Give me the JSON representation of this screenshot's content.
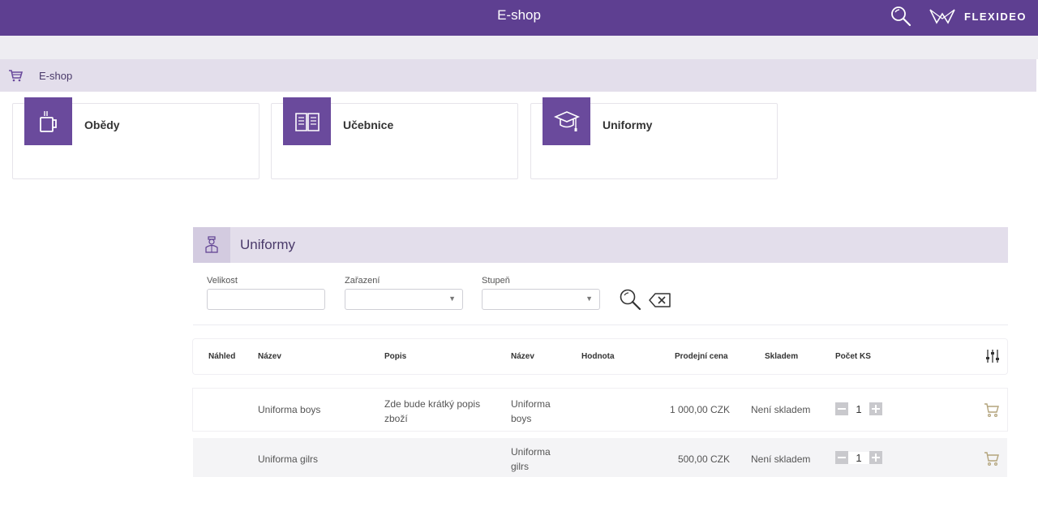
{
  "app": {
    "title": "E-shop",
    "brand": "FLEXIDEO"
  },
  "breadcrumb": {
    "label": "E-shop"
  },
  "categories": [
    {
      "label": "Obědy",
      "icon": "mug-icon"
    },
    {
      "label": "Učebnice",
      "icon": "book-icon"
    },
    {
      "label": "Uniformy",
      "icon": "graduation-cap-icon"
    }
  ],
  "panel": {
    "title": "Uniformy",
    "icon": "uniform-person-icon",
    "filters": {
      "velikost": {
        "label": "Velikost",
        "value": ""
      },
      "zarazeni": {
        "label": "Zařazení",
        "value": ""
      },
      "stupen": {
        "label": "Stupeň",
        "value": ""
      }
    }
  },
  "table": {
    "columns": [
      "Náhled",
      "Název",
      "Popis",
      "Název",
      "Hodnota",
      "Prodejní cena",
      "Skladem",
      "Počet KS"
    ],
    "rows": [
      {
        "nahled": "",
        "nazev": "Uniforma boys",
        "popis": "Zde bude krátký popis zboží",
        "nazev2": "Uniforma boys",
        "hodnota": "",
        "cena": "1 000,00 CZK",
        "skladem": "Není skladem",
        "pocet": "1"
      },
      {
        "nahled": "",
        "nazev": "Uniforma gilrs",
        "popis": "",
        "nazev2": "Uniforma gilrs",
        "hodnota": "",
        "cena": "500,00 CZK",
        "skladem": "Není skladem",
        "pocet": "1"
      }
    ]
  },
  "colors": {
    "accent": "#5e3f91",
    "tile": "#6a4a9c",
    "headerBg": "#e3deeb"
  }
}
